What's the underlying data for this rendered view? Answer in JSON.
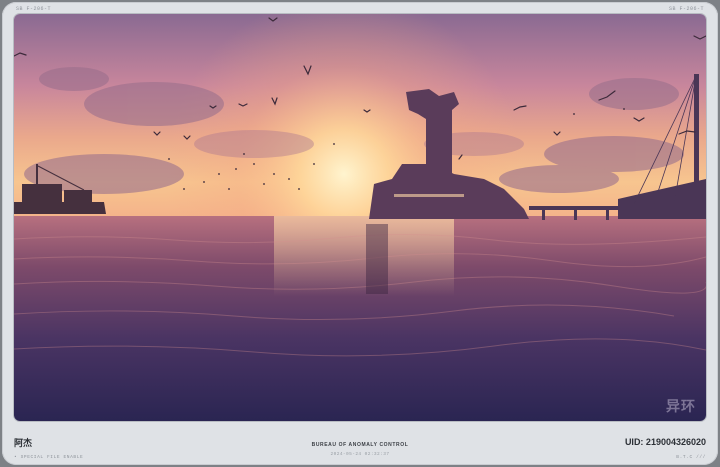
{
  "frame": {
    "corner_left": "SB  F-206-T",
    "corner_right": "SB  F-206-T"
  },
  "photo": {
    "scene": "sunset-sea-tower",
    "watermark": "异环"
  },
  "footer": {
    "name": "阿杰",
    "left_sub": "• SPECIAL FILE ENABLE",
    "center_title": "BUREAU OF ANOMALY CONTROL",
    "center_date": "2024-05-24 02:32:37",
    "uid": "UID: 219004326020",
    "right_sub": "B.T.C ///"
  },
  "colors": {
    "frame_bg": "#dfe2e6",
    "outer_bg": "#7d8186",
    "text_dark": "#2c3036"
  }
}
